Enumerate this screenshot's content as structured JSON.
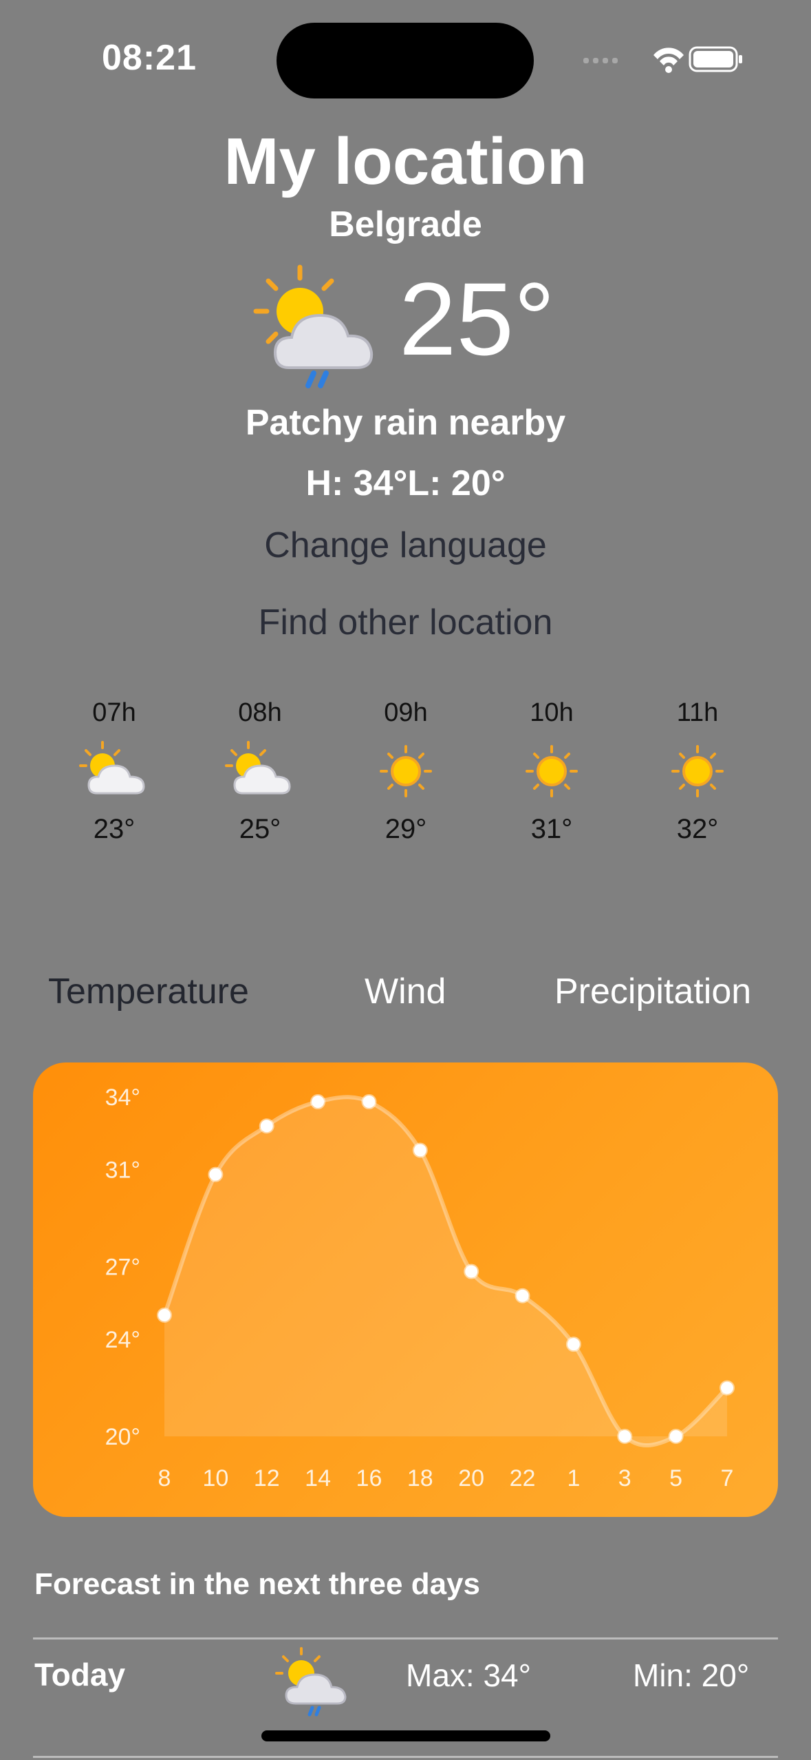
{
  "status": {
    "time": "08:21"
  },
  "header": {
    "title": "My location",
    "city": "Belgrade",
    "current_temp": "25°",
    "condition": "Patchy rain nearby",
    "hilo": "H: 34°L: 20°"
  },
  "links": {
    "change_language": "Change language",
    "find_location": "Find other location"
  },
  "hourly": [
    {
      "time": "07h",
      "icon": "partly-cloudy-icon",
      "temp": "23°"
    },
    {
      "time": "08h",
      "icon": "partly-cloudy-icon",
      "temp": "25°"
    },
    {
      "time": "09h",
      "icon": "sun-icon",
      "temp": "29°"
    },
    {
      "time": "10h",
      "icon": "sun-icon",
      "temp": "31°"
    },
    {
      "time": "11h",
      "icon": "sun-icon",
      "temp": "32°"
    }
  ],
  "tabs": {
    "temperature": "Temperature",
    "wind": "Wind",
    "precipitation": "Precipitation"
  },
  "colors": {
    "chart_bg": "#ff9a17",
    "page_bg": "#808080"
  },
  "chart_data": {
    "type": "area",
    "categories": [
      "8",
      "10",
      "12",
      "14",
      "16",
      "18",
      "20",
      "22",
      "1",
      "3",
      "5",
      "7"
    ],
    "values": [
      25,
      30.8,
      32.8,
      33.8,
      33.8,
      31.8,
      26.8,
      25.8,
      23.8,
      20,
      20,
      22
    ],
    "y_ticks": [
      "34°",
      "31°",
      "27°",
      "24°",
      "20°"
    ],
    "ylim": [
      20,
      34
    ]
  },
  "forecast": {
    "title": "Forecast in the next three days",
    "rows": [
      {
        "day": "Today",
        "icon": "rain-cloud-sun-icon",
        "max": "Max: 34°",
        "min": "Min: 20°"
      }
    ]
  }
}
